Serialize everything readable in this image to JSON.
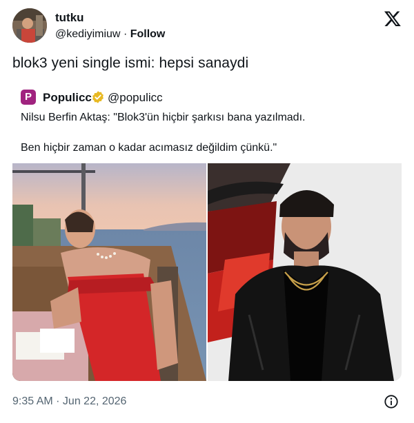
{
  "author": {
    "name": "tutku",
    "handle": "@kediyimiuw",
    "separator": "·",
    "follow_label": "Follow"
  },
  "tweet": {
    "text": "blok3 yeni single ismi: hepsi sanaydi",
    "timestamp": "9:35 AM · Jun 22, 2026"
  },
  "quote": {
    "logo_letter": "P",
    "name": "Populicc",
    "handle": "@populicc",
    "line1": "Nilsu Berfin Aktaş: \"Blok3'ün hiçbir şarkısı bana yazılmadı.",
    "line2": "Ben hiçbir zaman o kadar acımasız değildim çünkü.\"",
    "brand_color": "#a0237f",
    "verified_color": "#e8b923"
  },
  "icons": {
    "platform_logo": "x-logo-icon",
    "info": "info-icon",
    "verified": "verified-badge-icon"
  },
  "media": [
    {
      "name": "woman-in-red-dress-photo"
    },
    {
      "name": "man-in-leather-jacket-photo"
    }
  ]
}
